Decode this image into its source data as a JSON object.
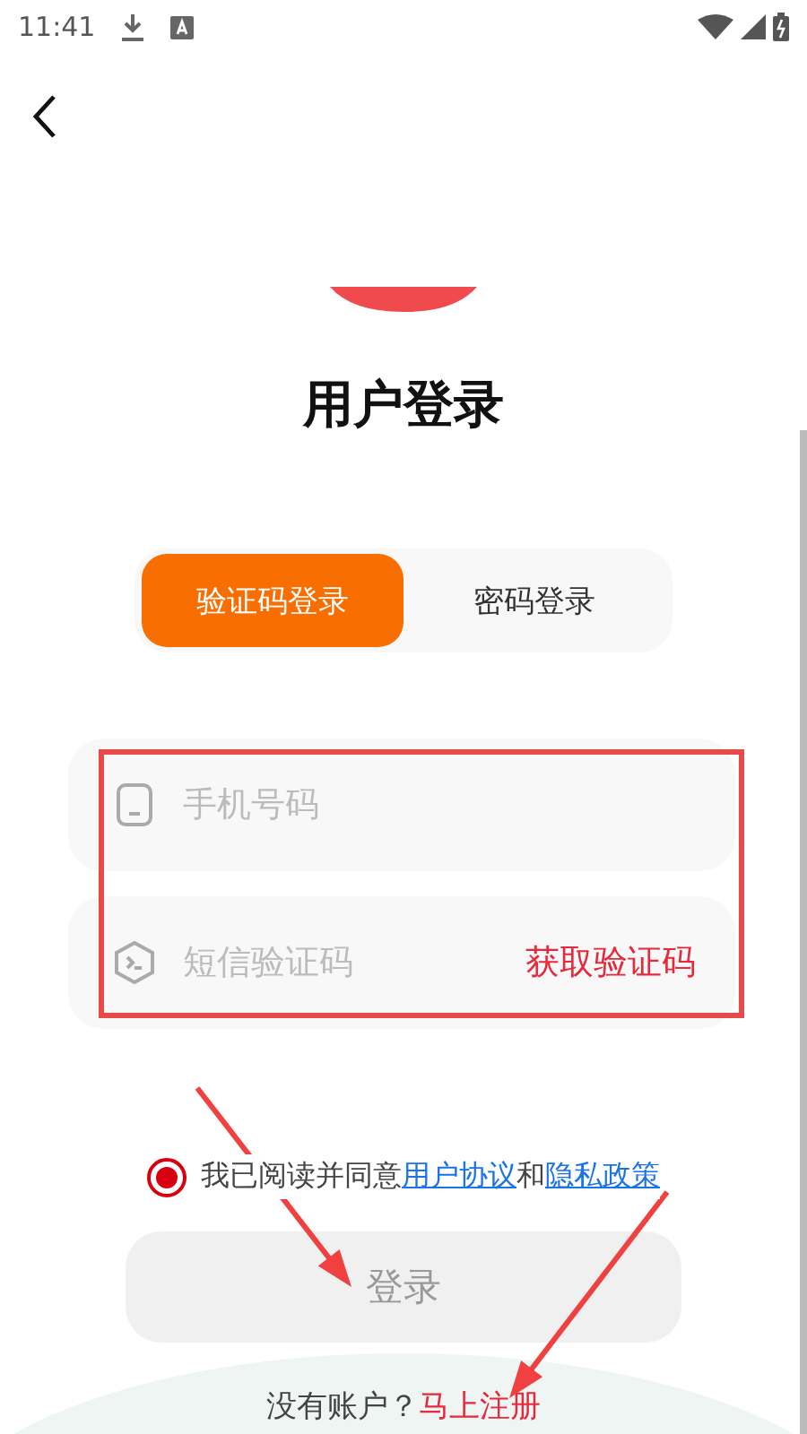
{
  "status_bar": {
    "time": "11:41"
  },
  "title": "用户登录",
  "tabs": [
    {
      "label": "验证码登录",
      "selected": true
    },
    {
      "label": "密码登录",
      "selected": false
    }
  ],
  "fields": [
    {
      "kind": "phone",
      "placeholder": "手机号码"
    },
    {
      "kind": "code",
      "placeholder": "短信验证码",
      "action": "获取验证码"
    }
  ],
  "agreement": {
    "checked": true,
    "parts": [
      {
        "kind": "plain",
        "text": "我已阅读并同意"
      },
      {
        "kind": "link",
        "text": "用户协议"
      },
      {
        "kind": "plain",
        "text": "和"
      },
      {
        "kind": "link",
        "text": "隐私政策"
      }
    ]
  },
  "login_button": {
    "label": "登录",
    "disabled": true
  },
  "footer": {
    "prompt": "没有账户？",
    "link": "马上注册"
  }
}
